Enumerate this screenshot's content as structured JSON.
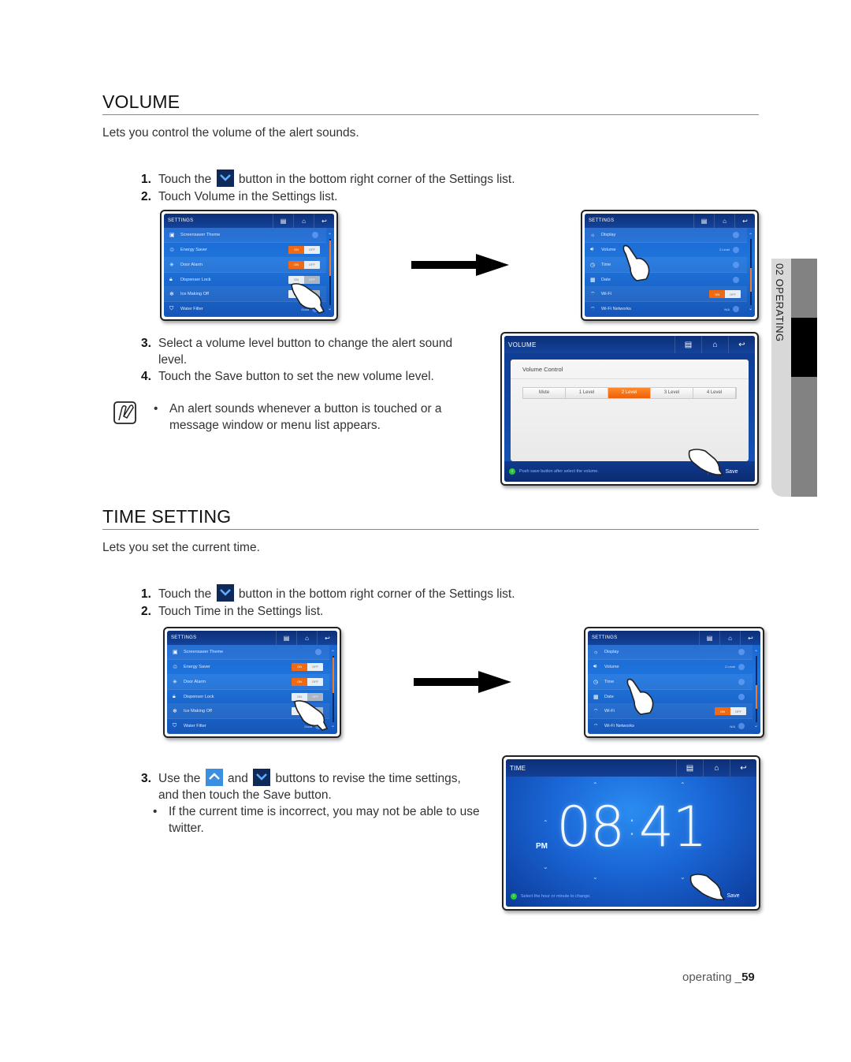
{
  "volume_section": {
    "title": "VOLUME",
    "intro": "Lets you control the volume of the alert sounds.",
    "steps": [
      {
        "num": "1.",
        "pre": "Touch the",
        "icon": "chevron-down-button-icon",
        "post": "button in the bottom right corner of the Settings list."
      },
      {
        "num": "2.",
        "text": "Touch Volume in the Settings list."
      },
      {
        "num": "3.",
        "text": "Select a volume level button to change the alert sound level."
      },
      {
        "num": "4.",
        "text": "Touch the Save button to set the new volume level."
      }
    ],
    "note": "An alert sounds whenever a button is touched or a message window or menu list appears."
  },
  "time_section": {
    "title": "TIME SETTING",
    "intro": "Lets you set the current time.",
    "steps": [
      {
        "num": "1.",
        "pre": "Touch the",
        "icon": "chevron-down-button-icon",
        "post": "button in the bottom right corner of the Settings list."
      },
      {
        "num": "2.",
        "text": "Touch Time in the Settings list."
      },
      {
        "num": "3.",
        "pre": "Use the",
        "mid": "and",
        "post": "buttons to revise the time settings,",
        "line2": "and then touch the Save button."
      }
    ],
    "bullet": "If the current time is incorrect, you may not be able to use twitter."
  },
  "settings_screen_1": {
    "title": "SETTINGS",
    "rows": [
      {
        "icon": "screensaver-icon",
        "label": "Screensaver Theme",
        "type": "chevron"
      },
      {
        "icon": "energy-saver-icon",
        "label": "Energy Saver",
        "type": "toggle",
        "on": "ON",
        "off": "OFF",
        "state": "on"
      },
      {
        "icon": "door-alarm-icon",
        "label": "Door Alarm",
        "type": "toggle",
        "on": "ON",
        "off": "OFF",
        "state": "on"
      },
      {
        "icon": "lock-icon",
        "label": "Dispenser Lock",
        "type": "toggle",
        "on": "ON",
        "off": "OFF",
        "state": "off"
      },
      {
        "icon": "ice-icon",
        "label": "Ice Making Off",
        "type": "toggle",
        "on": "ON",
        "off": "OFF",
        "state": "off"
      },
      {
        "icon": "water-filter-icon",
        "label": "Water Filter",
        "type": "value",
        "value": "Good"
      }
    ]
  },
  "settings_screen_2": {
    "title": "SETTINGS",
    "rows": [
      {
        "icon": "display-icon",
        "label": "Display",
        "type": "chevron"
      },
      {
        "icon": "volume-icon",
        "label": "Volume",
        "type": "value",
        "value": "2 Level"
      },
      {
        "icon": "clock-icon",
        "label": "Time",
        "type": "chevron"
      },
      {
        "icon": "calendar-icon",
        "label": "Date",
        "type": "chevron"
      },
      {
        "icon": "wifi-icon",
        "label": "Wi-Fi",
        "type": "toggle",
        "on": "ON",
        "off": "OFF",
        "state": "on"
      },
      {
        "icon": "wifi-icon",
        "label": "Wi-Fi Networks",
        "type": "value",
        "value": "N/A"
      }
    ]
  },
  "volume_screen": {
    "title": "VOLUME",
    "panel_title": "Volume Control",
    "levels": [
      "Mute",
      "1 Level",
      "2 Level",
      "3 Level",
      "4 Level"
    ],
    "selected": "2 Level",
    "hint": "Push save button after select the volume.",
    "save": "Save"
  },
  "time_screen": {
    "title": "TIME",
    "hour": "08",
    "minute": "41",
    "ampm": "PM",
    "hint": "Select the hour or minute to change.",
    "save": "Save"
  },
  "side_tab": {
    "label": "02 OPERATING"
  },
  "footer": {
    "section": "operating _",
    "page": "59"
  },
  "colors": {
    "accent_orange": "#f06a14",
    "screen_blue": "#1e75dd",
    "topbar_navy": "#0d2f78"
  }
}
